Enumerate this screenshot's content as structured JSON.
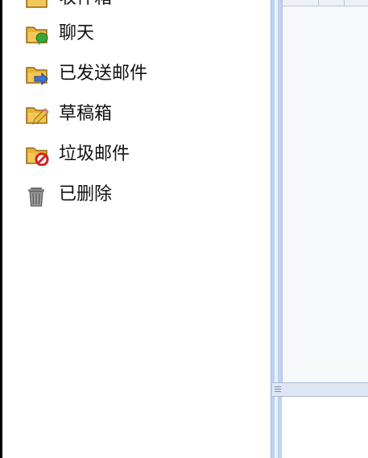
{
  "sidebar": {
    "items": [
      {
        "label": "收件箱",
        "icon": "inbox-folder-icon"
      },
      {
        "label": "聊天",
        "icon": "chat-folder-icon"
      },
      {
        "label": "已发送邮件",
        "icon": "sent-folder-icon"
      },
      {
        "label": "草稿箱",
        "icon": "drafts-folder-icon"
      },
      {
        "label": "垃圾邮件",
        "icon": "spam-folder-icon"
      },
      {
        "label": "已删除",
        "icon": "trash-icon"
      }
    ]
  },
  "colors": {
    "folder": "#e8b23a",
    "folder_dark": "#b9831c",
    "chat_bubble": "#3aa63a",
    "sent_arrow": "#3f74d6",
    "pencil": "#f0c040",
    "spam_badge": "#d42020",
    "divider": "#bcd2ee"
  }
}
